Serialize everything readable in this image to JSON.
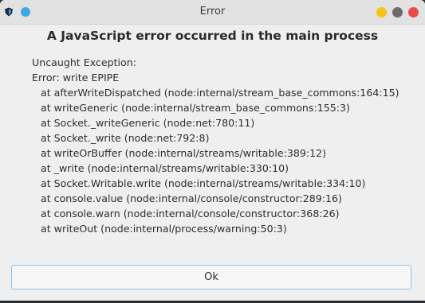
{
  "window": {
    "title": "Error"
  },
  "dialog": {
    "heading": "A JavaScript error occurred in the main process",
    "message_lines": [
      "Uncaught Exception:",
      "Error: write EPIPE",
      "at afterWriteDispatched (node:internal/stream_base_commons:164:15)",
      "at writeGeneric (node:internal/stream_base_commons:155:3)",
      "at Socket._writeGeneric (node:net:780:11)",
      "at Socket._write (node:net:792:8)",
      "at writeOrBuffer (node:internal/streams/writable:389:12)",
      "at _write (node:internal/streams/writable:330:10)",
      "at Socket.Writable.write (node:internal/streams/writable:334:10)",
      "at console.value (node:internal/console/constructor:289:16)",
      "at console.warn (node:internal/console/constructor:368:26)",
      "at writeOut (node:internal/process/warning:50:3)"
    ],
    "ok_label": "Ok"
  },
  "colors": {
    "minimize": "#f5c518",
    "maximize": "#6b6b6b",
    "close": "#e94b4b",
    "app_dot": "#3ea7e8",
    "button_border": "#8fc3e6"
  },
  "icons": {
    "app": "shield-icon",
    "app_dot": "circle-icon",
    "minimize": "minimize-icon",
    "maximize": "maximize-icon",
    "close": "close-icon"
  }
}
